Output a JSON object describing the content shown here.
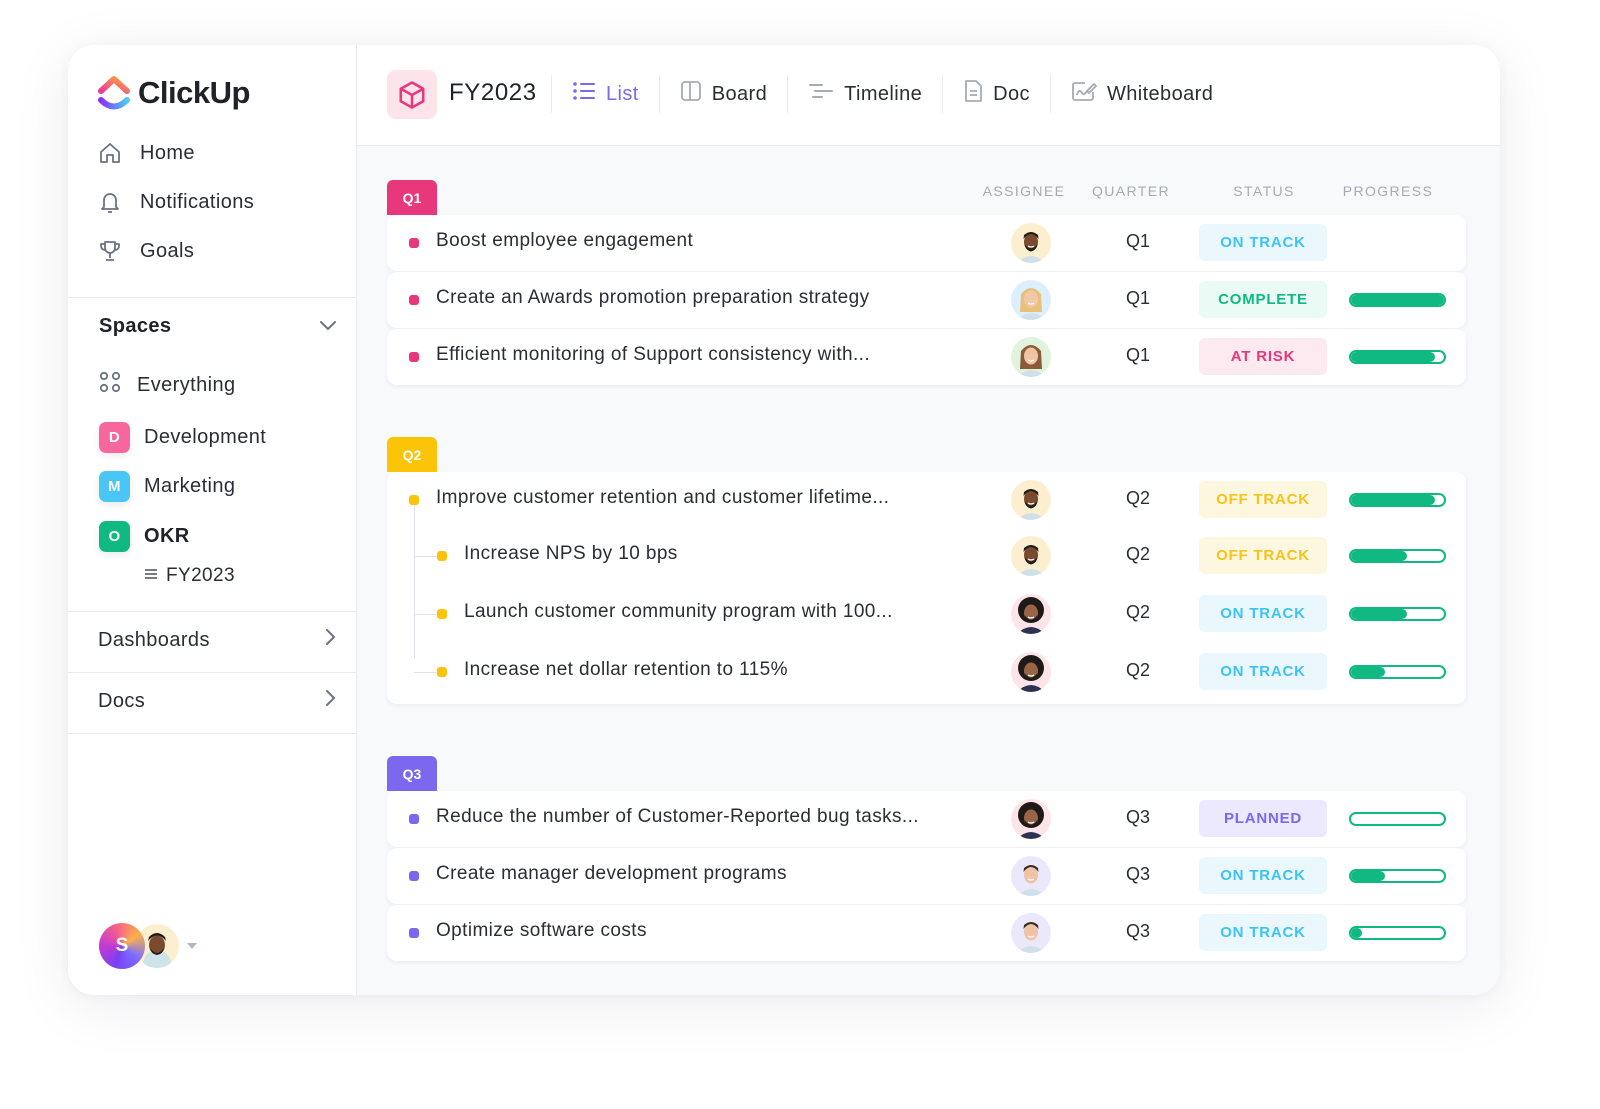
{
  "app": {
    "name": "ClickUp"
  },
  "sidebar": {
    "nav": [
      {
        "label": "Home",
        "icon": "home-icon"
      },
      {
        "label": "Notifications",
        "icon": "bell-icon"
      },
      {
        "label": "Goals",
        "icon": "trophy-icon"
      }
    ],
    "spaces_title": "Spaces",
    "everything_label": "Everything",
    "spaces": [
      {
        "initial": "D",
        "label": "Development",
        "color": "#f7679e"
      },
      {
        "initial": "M",
        "label": "Marketing",
        "color": "#49c6f5"
      },
      {
        "initial": "O",
        "label": "OKR",
        "color": "#10b981"
      }
    ],
    "sub_list": "FY2023",
    "dashboards_label": "Dashboards",
    "docs_label": "Docs",
    "user_initial": "S"
  },
  "header": {
    "title": "FY2023",
    "tabs": [
      {
        "label": "List",
        "icon": "list-icon",
        "active": true
      },
      {
        "label": "Board",
        "icon": "board-icon"
      },
      {
        "label": "Timeline",
        "icon": "timeline-icon"
      },
      {
        "label": "Doc",
        "icon": "doc-icon"
      },
      {
        "label": "Whiteboard",
        "icon": "whiteboard-icon"
      }
    ],
    "accent": "#7b68ee"
  },
  "columns": {
    "assignee": "ASSIGNEE",
    "quarter": "QUARTER",
    "status": "STATUS",
    "progress": "PROGRESS"
  },
  "status_styles": {
    "ON TRACK": {
      "fg": "#3cc3f5",
      "bg": "#eaf8fe"
    },
    "COMPLETE": {
      "fg": "#10b981",
      "bg": "#eafaf4"
    },
    "AT RISK": {
      "fg": "#e8377a",
      "bg": "#fde9f0"
    },
    "OFF TRACK": {
      "fg": "#f6c21b",
      "bg": "#fef7df"
    },
    "PLANNED": {
      "fg": "#7b68ee",
      "bg": "#ece8fd"
    }
  },
  "groups": [
    {
      "tag": "Q1",
      "color": "#e8377a",
      "tasks": [
        {
          "name": "Boost employee engagement",
          "quarter": "Q1",
          "status": "ON TRACK",
          "progress": null,
          "avatar": "man-beard"
        },
        {
          "name": "Create an Awards promotion preparation strategy",
          "quarter": "Q1",
          "status": "COMPLETE",
          "progress": 100,
          "avatar": "woman-blonde"
        },
        {
          "name": "Efficient monitoring of Support consistency with...",
          "quarter": "Q1",
          "status": "AT RISK",
          "progress": 90,
          "avatar": "woman-brunette"
        }
      ]
    },
    {
      "tag": "Q2",
      "color": "#fbc409",
      "tasks": [
        {
          "name": "Improve customer retention and customer lifetime...",
          "quarter": "Q2",
          "status": "OFF TRACK",
          "progress": 90,
          "avatar": "man-beard",
          "level": 0
        },
        {
          "name": "Increase NPS by 10 bps",
          "quarter": "Q2",
          "status": "OFF TRACK",
          "progress": 60,
          "avatar": "man-beard",
          "level": 1
        },
        {
          "name": "Launch customer community program with 100...",
          "quarter": "Q2",
          "status": "ON TRACK",
          "progress": 60,
          "avatar": "man-afro",
          "level": 1
        },
        {
          "name": "Increase net dollar retention to 115%",
          "quarter": "Q2",
          "status": "ON TRACK",
          "progress": 37,
          "avatar": "man-afro",
          "level": 1
        }
      ]
    },
    {
      "tag": "Q3",
      "color": "#7b68ee",
      "tasks": [
        {
          "name": "Reduce the number of Customer-Reported bug tasks...",
          "quarter": "Q3",
          "status": "PLANNED",
          "progress": 0,
          "avatar": "man-afro"
        },
        {
          "name": "Create manager development programs",
          "quarter": "Q3",
          "status": "ON TRACK",
          "progress": 37,
          "avatar": "man-short"
        },
        {
          "name": "Optimize software costs",
          "quarter": "Q3",
          "status": "ON TRACK",
          "progress": 12,
          "avatar": "man-short"
        }
      ]
    }
  ]
}
